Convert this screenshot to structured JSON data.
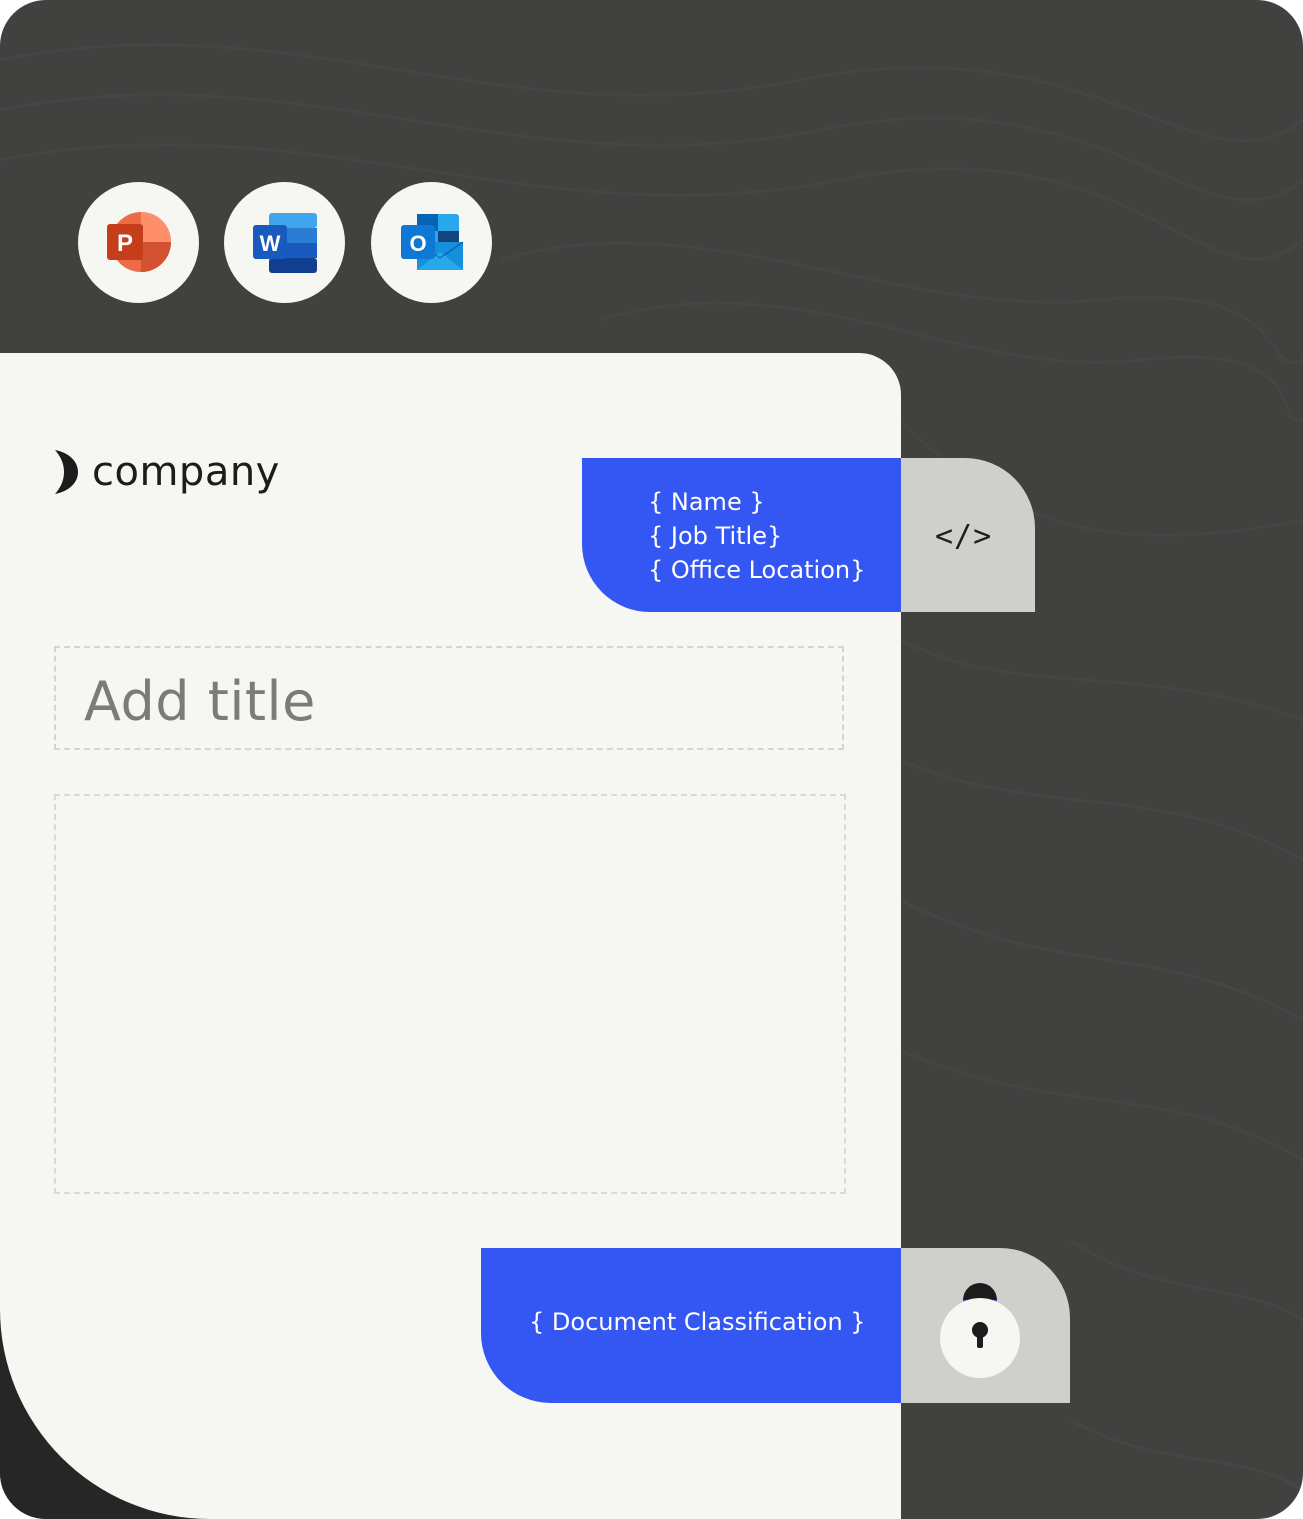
{
  "apps": [
    {
      "name": "PowerPoint",
      "icon": "powerpoint-icon",
      "letter": "P",
      "color": "#c43e1c"
    },
    {
      "name": "Word",
      "icon": "word-icon",
      "letter": "W",
      "color": "#185abd"
    },
    {
      "name": "Outlook",
      "icon": "outlook-icon",
      "letter": "O",
      "color": "#0f78d4"
    }
  ],
  "document": {
    "logo_text": "company",
    "title_placeholder": "Add title"
  },
  "signature_fields": {
    "name": "{ Name }",
    "job_title": "{ Job Title}",
    "office_location": "{ Office Location}",
    "code_icon": "code-icon",
    "code_symbol": "</>"
  },
  "classification": {
    "label": "{ Document Classification }",
    "icon": "lock-icon"
  },
  "colors": {
    "accent": "#3456f2",
    "background": "#414240",
    "document": "#f6f7f2",
    "tab": "#cfd0cc"
  }
}
